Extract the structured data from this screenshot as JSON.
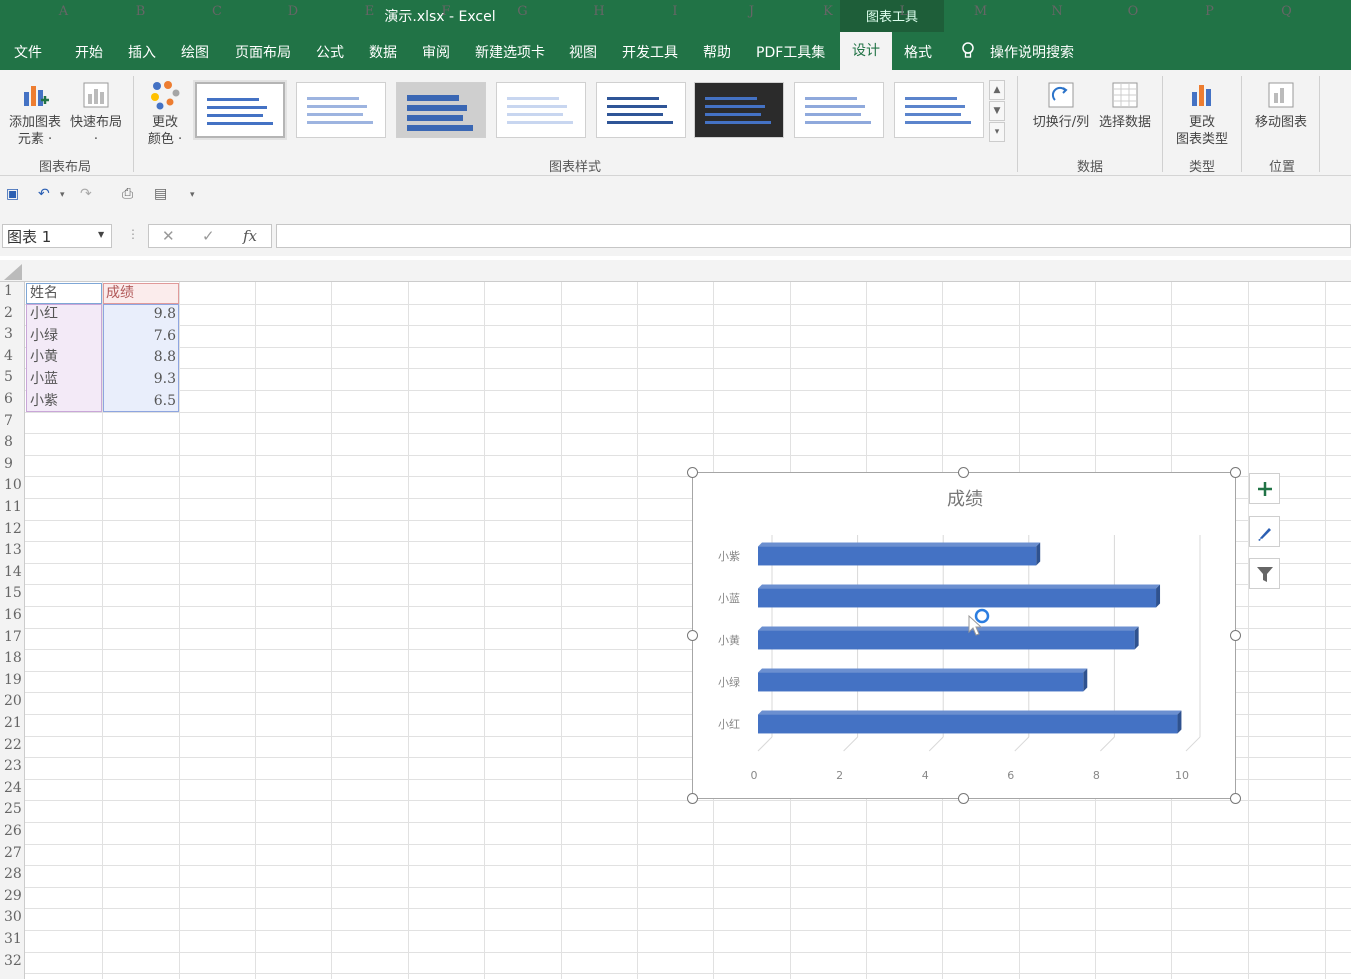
{
  "window": {
    "title": "演示.xlsx  -  Excel",
    "context_tab_title": "图表工具"
  },
  "tabs": [
    {
      "label": "文件"
    },
    {
      "label": "开始"
    },
    {
      "label": "插入"
    },
    {
      "label": "绘图"
    },
    {
      "label": "页面布局"
    },
    {
      "label": "公式"
    },
    {
      "label": "数据"
    },
    {
      "label": "审阅"
    },
    {
      "label": "新建选项卡"
    },
    {
      "label": "视图"
    },
    {
      "label": "开发工具"
    },
    {
      "label": "帮助"
    },
    {
      "label": "PDF工具集"
    },
    {
      "label": "设计",
      "active": true
    },
    {
      "label": "格式"
    }
  ],
  "tell_me": "操作说明搜索",
  "ribbon": {
    "add_element": [
      "添加图表",
      "元素 ·"
    ],
    "quick_layout": [
      "快速布局",
      "·"
    ],
    "group_layout": "图表布局",
    "change_colors": [
      "更改",
      "颜色 ·"
    ],
    "group_styles": "图表样式",
    "switch_row_col": "切换行/列",
    "select_data": "选择数据",
    "group_data": "数据",
    "change_type": [
      "更改",
      "图表类型"
    ],
    "group_type": "类型",
    "move_chart": "移动图表",
    "group_location": "位置"
  },
  "formula_bar": {
    "name_box": "图表 1",
    "fx": "fx",
    "cancel": "✕",
    "confirm": "✓",
    "value": ""
  },
  "columns": [
    "A",
    "B",
    "C",
    "D",
    "E",
    "F",
    "G",
    "H",
    "I",
    "J",
    "K",
    "L",
    "M",
    "N",
    "O",
    "P",
    "Q"
  ],
  "rows": [
    "1",
    "2",
    "3",
    "4",
    "5",
    "6",
    "7",
    "8",
    "9",
    "10",
    "11",
    "12",
    "13",
    "14",
    "15",
    "16",
    "17",
    "18",
    "19",
    "20",
    "21",
    "22",
    "23",
    "24",
    "25",
    "26",
    "27",
    "28",
    "29",
    "30",
    "31",
    "32"
  ],
  "sheet": {
    "header": {
      "name": "姓名",
      "score": "成绩"
    },
    "records": [
      {
        "name": "小红",
        "score": "9.8"
      },
      {
        "name": "小绿",
        "score": "7.6"
      },
      {
        "name": "小黄",
        "score": "8.8"
      },
      {
        "name": "小蓝",
        "score": "9.3"
      },
      {
        "name": "小紫",
        "score": "6.5"
      }
    ]
  },
  "colors": {
    "excel_green": "#217346",
    "bar_blue": "#4472c4"
  },
  "chart_data": {
    "type": "bar",
    "orientation": "horizontal",
    "title": "成绩",
    "categories": [
      "小红",
      "小绿",
      "小黄",
      "小蓝",
      "小紫"
    ],
    "values": [
      9.8,
      7.6,
      8.8,
      9.3,
      6.5
    ],
    "xlim": [
      0,
      10
    ],
    "xticks": [
      "0",
      "2",
      "4",
      "6",
      "8",
      "10"
    ],
    "grid": true,
    "legend": "none"
  }
}
